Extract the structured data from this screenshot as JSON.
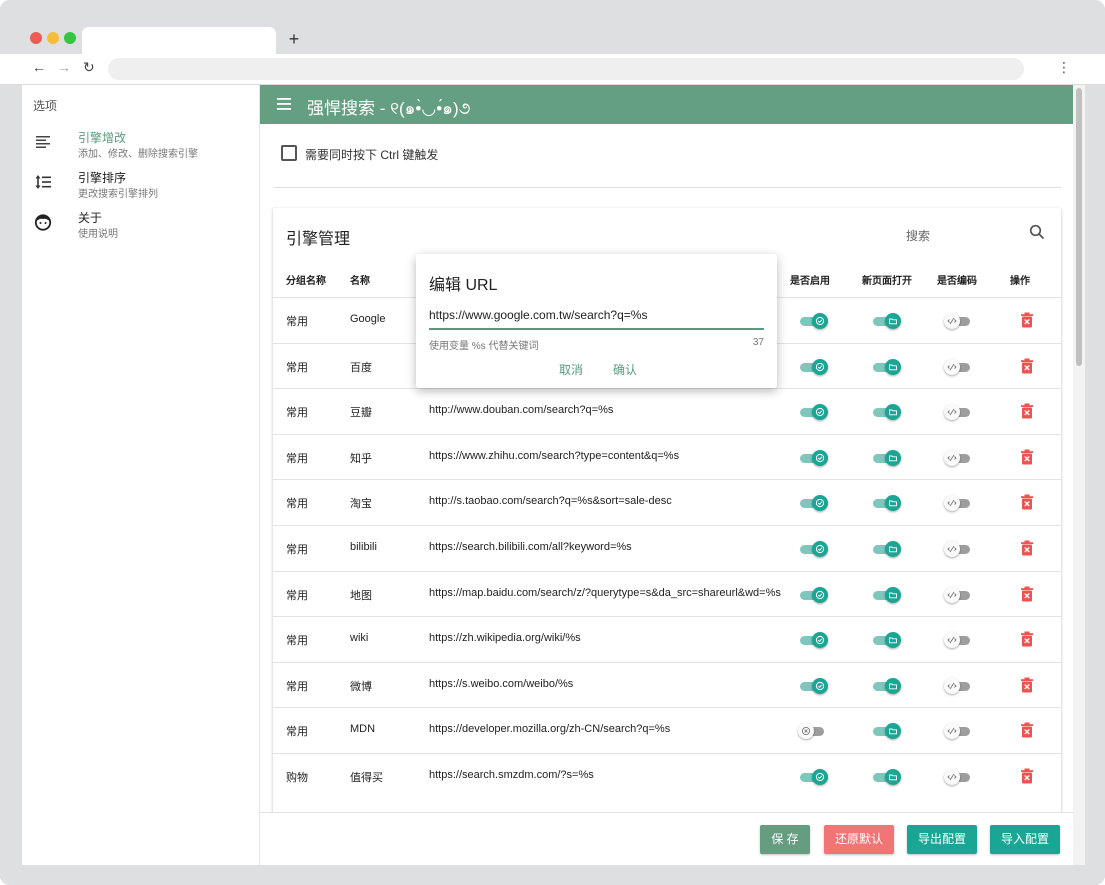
{
  "browser": {
    "tab_title": "",
    "new_tab": "+",
    "back": "←",
    "forward": "→",
    "reload": "↻",
    "menu": "⋮"
  },
  "sidebar": {
    "heading": "选项",
    "items": [
      {
        "title": "引擎增改",
        "subtitle": "添加、修改、删除搜索引擎",
        "icon": "align-left-icon",
        "active": true
      },
      {
        "title": "引擎排序",
        "subtitle": "更改搜索引擎排列",
        "icon": "sort-icon",
        "active": false
      },
      {
        "title": "关于",
        "subtitle": "使用说明",
        "icon": "face-icon",
        "active": false
      }
    ]
  },
  "appbar": {
    "title": "强悍搜索 - ୧(๑•̀◡•́๑)૭"
  },
  "options": {
    "ctrl_label": "需要同时按下 Ctrl 键触发",
    "ctrl_checked": false
  },
  "engines": {
    "title": "引擎管理",
    "search_placeholder": "搜索",
    "headers": {
      "group": "分组名称",
      "name": "名称",
      "enabled": "是否启用",
      "newtab": "新页面打开",
      "encode": "是否编码",
      "actions": "操作"
    },
    "rows": [
      {
        "group": "常用",
        "name": "Google",
        "url": "",
        "enabled": true,
        "newtab": true,
        "encode": false
      },
      {
        "group": "常用",
        "name": "百度",
        "url": "",
        "enabled": true,
        "newtab": true,
        "encode": false
      },
      {
        "group": "常用",
        "name": "豆瓣",
        "url": "http://www.douban.com/search?q=%s",
        "enabled": true,
        "newtab": true,
        "encode": false
      },
      {
        "group": "常用",
        "name": "知乎",
        "url": "https://www.zhihu.com/search?type=content&q=%s",
        "enabled": true,
        "newtab": true,
        "encode": false
      },
      {
        "group": "常用",
        "name": "淘宝",
        "url": "http://s.taobao.com/search?q=%s&sort=sale-desc",
        "enabled": true,
        "newtab": true,
        "encode": false
      },
      {
        "group": "常用",
        "name": "bilibili",
        "url": "https://search.bilibili.com/all?keyword=%s",
        "enabled": true,
        "newtab": true,
        "encode": false
      },
      {
        "group": "常用",
        "name": "地图",
        "url": "https://map.baidu.com/search/z/?querytype=s&da_src=shareurl&wd=%s",
        "enabled": true,
        "newtab": true,
        "encode": false
      },
      {
        "group": "常用",
        "name": "wiki",
        "url": "https://zh.wikipedia.org/wiki/%s",
        "enabled": true,
        "newtab": true,
        "encode": false
      },
      {
        "group": "常用",
        "name": "微博",
        "url": "https://s.weibo.com/weibo/%s",
        "enabled": true,
        "newtab": true,
        "encode": false
      },
      {
        "group": "常用",
        "name": "MDN",
        "url": "https://developer.mozilla.org/zh-CN/search?q=%s",
        "enabled": false,
        "newtab": true,
        "encode": false
      },
      {
        "group": "购物",
        "name": "值得买",
        "url": "https://search.smzdm.com/?s=%s",
        "enabled": true,
        "newtab": true,
        "encode": false
      }
    ]
  },
  "dialog": {
    "title": "编辑 URL",
    "value": "https://www.google.com.tw/search?q=%s",
    "hint": "使用变量 %s 代替关键词",
    "count": "37",
    "cancel": "取消",
    "confirm": "确认"
  },
  "footer": {
    "buttons": [
      {
        "label": "保 存",
        "color": "#669c80"
      },
      {
        "label": "还原默认",
        "color": "#f27575"
      },
      {
        "label": "导出配置",
        "color": "#1aa694"
      },
      {
        "label": "导入配置",
        "color": "#1aa694"
      }
    ]
  },
  "colors": {
    "accent": "#659f82",
    "teal": "#1aa694",
    "danger": "#ef5350"
  }
}
